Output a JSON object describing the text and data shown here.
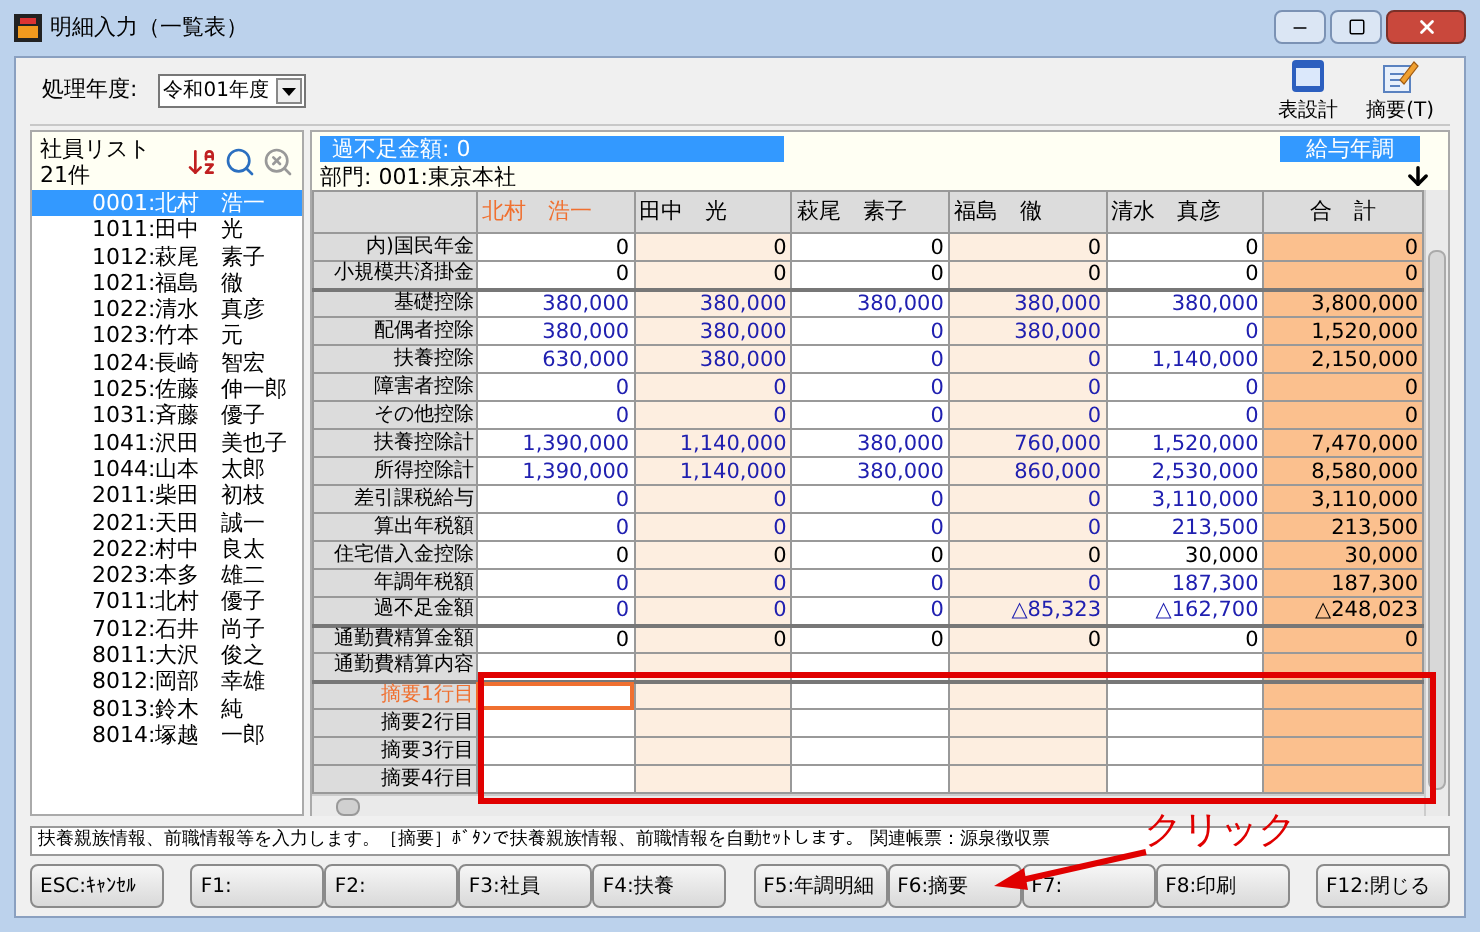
{
  "window": {
    "title": "明細入力（一覧表）"
  },
  "toolbar": {
    "year_label": "処理年度:",
    "year_value": "令和01年度",
    "buttons": [
      {
        "label": "表設計",
        "kind": "layout"
      },
      {
        "label": "摘要(T)",
        "kind": "memo"
      }
    ]
  },
  "employee_list": {
    "title": "社員リスト",
    "count": "21件",
    "items": [
      {
        "label": "0001:北村　浩一",
        "selected": true
      },
      {
        "label": "1011:田中　光",
        "selected": false
      },
      {
        "label": "1012:萩尾　素子",
        "selected": false
      },
      {
        "label": "1021:福島　徹",
        "selected": false
      },
      {
        "label": "1022:清水　真彦",
        "selected": false
      },
      {
        "label": "1023:竹本　元",
        "selected": false
      },
      {
        "label": "1024:長崎　智宏",
        "selected": false
      },
      {
        "label": "1025:佐藤　伸一郎",
        "selected": false
      },
      {
        "label": "1031:斉藤　優子",
        "selected": false
      },
      {
        "label": "1041:沢田　美也子",
        "selected": false
      },
      {
        "label": "1044:山本　太郎",
        "selected": false
      },
      {
        "label": "2011:柴田　初枝",
        "selected": false
      },
      {
        "label": "2021:天田　誠一",
        "selected": false
      },
      {
        "label": "2022:村中　良太",
        "selected": false
      },
      {
        "label": "2023:本多　雄二",
        "selected": false
      },
      {
        "label": "7011:北村　優子",
        "selected": false
      },
      {
        "label": "7012:石井　尚子",
        "selected": false
      },
      {
        "label": "8011:大沢　俊之",
        "selected": false
      },
      {
        "label": "8012:岡部　幸雄",
        "selected": false
      },
      {
        "label": "8013:鈴木　純",
        "selected": false
      },
      {
        "label": "8014:塚越　一郎",
        "selected": false
      }
    ]
  },
  "info": {
    "shortage": "過不足金額: 0",
    "department": "部門: 001:東京本社",
    "mode": "給与年調"
  },
  "table": {
    "columns": [
      {
        "label": "北村　浩一",
        "kind": "employee",
        "selected": true
      },
      {
        "label": "田中　光",
        "kind": "employee",
        "selected": false
      },
      {
        "label": "萩尾　素子",
        "kind": "employee",
        "selected": false
      },
      {
        "label": "福島　徹",
        "kind": "employee",
        "selected": false
      },
      {
        "label": "清水　真彦",
        "kind": "employee",
        "selected": false
      },
      {
        "label": "合　計",
        "kind": "total",
        "selected": false
      }
    ],
    "rows": [
      {
        "label": "内)国民年金",
        "kind": "input",
        "section_start": false,
        "selected": false,
        "values": [
          "0",
          "0",
          "0",
          "0",
          "0",
          "0"
        ]
      },
      {
        "label": "小規模共済掛金",
        "kind": "input",
        "section_start": false,
        "selected": false,
        "values": [
          "0",
          "0",
          "0",
          "0",
          "0",
          "0"
        ]
      },
      {
        "label": "基礎控除",
        "kind": "calc",
        "section_start": true,
        "selected": false,
        "values": [
          "380,000",
          "380,000",
          "380,000",
          "380,000",
          "380,000",
          "3,800,000"
        ]
      },
      {
        "label": "配偶者控除",
        "kind": "calc",
        "section_start": false,
        "selected": false,
        "values": [
          "380,000",
          "380,000",
          "0",
          "380,000",
          "0",
          "1,520,000"
        ]
      },
      {
        "label": "扶養控除",
        "kind": "calc",
        "section_start": false,
        "selected": false,
        "values": [
          "630,000",
          "380,000",
          "0",
          "0",
          "1,140,000",
          "2,150,000"
        ]
      },
      {
        "label": "障害者控除",
        "kind": "calc",
        "section_start": false,
        "selected": false,
        "values": [
          "0",
          "0",
          "0",
          "0",
          "0",
          "0"
        ]
      },
      {
        "label": "その他控除",
        "kind": "calc",
        "section_start": false,
        "selected": false,
        "values": [
          "0",
          "0",
          "0",
          "0",
          "0",
          "0"
        ]
      },
      {
        "label": "扶養控除計",
        "kind": "calc",
        "section_start": false,
        "selected": false,
        "values": [
          "1,390,000",
          "1,140,000",
          "380,000",
          "760,000",
          "1,520,000",
          "7,470,000"
        ]
      },
      {
        "label": "所得控除計",
        "kind": "calc",
        "section_start": false,
        "selected": false,
        "values": [
          "1,390,000",
          "1,140,000",
          "380,000",
          "860,000",
          "2,530,000",
          "8,580,000"
        ]
      },
      {
        "label": "差引課税給与",
        "kind": "calc",
        "section_start": false,
        "selected": false,
        "values": [
          "0",
          "0",
          "0",
          "0",
          "3,110,000",
          "3,110,000"
        ]
      },
      {
        "label": "算出年税額",
        "kind": "calc",
        "section_start": false,
        "selected": false,
        "values": [
          "0",
          "0",
          "0",
          "0",
          "213,500",
          "213,500"
        ]
      },
      {
        "label": "住宅借入金控除",
        "kind": "input",
        "section_start": false,
        "selected": false,
        "values": [
          "0",
          "0",
          "0",
          "0",
          "30,000",
          "30,000"
        ]
      },
      {
        "label": "年調年税額",
        "kind": "calc",
        "section_start": false,
        "selected": false,
        "values": [
          "0",
          "0",
          "0",
          "0",
          "187,300",
          "187,300"
        ]
      },
      {
        "label": "過不足金額",
        "kind": "calc",
        "section_start": false,
        "selected": false,
        "values": [
          "0",
          "0",
          "0",
          "△85,323",
          "△162,700",
          "△248,023"
        ]
      },
      {
        "label": "通勤費精算金額",
        "kind": "input",
        "section_start": true,
        "selected": false,
        "values": [
          "0",
          "0",
          "0",
          "0",
          "0",
          "0"
        ]
      },
      {
        "label": "通勤費精算内容",
        "kind": "input",
        "section_start": false,
        "selected": false
      },
      {
        "label": "摘要1行目",
        "kind": "input",
        "section_start": true,
        "selected": true
      },
      {
        "label": "摘要2行目",
        "kind": "input",
        "section_start": false,
        "selected": false
      },
      {
        "label": "摘要3行目",
        "kind": "input",
        "section_start": false,
        "selected": false
      },
      {
        "label": "摘要4行目",
        "kind": "input",
        "section_start": false,
        "selected": false
      }
    ]
  },
  "status_bar": "扶養親族情報、前職情報等を入力します。［摘要］ﾎﾞﾀﾝで扶養親族情報、前職情報を自動ｾｯﾄします。 関連帳票：源泉徴収票",
  "function_keys": [
    [
      "ESC:ｷｬﾝｾﾙ"
    ],
    [
      "F1:",
      "F2:",
      "F3:社員",
      "F4:扶養"
    ],
    [
      "F5:年調明細",
      "F6:摘要",
      "F7:",
      "F8:印刷"
    ],
    [
      "F12:閉じる"
    ]
  ],
  "annotation": {
    "text": "クリック"
  }
}
